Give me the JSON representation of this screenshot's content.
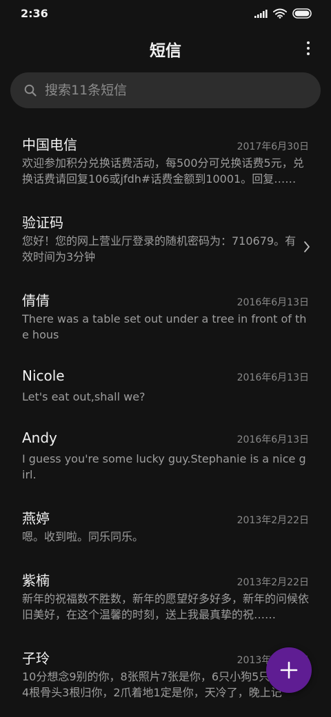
{
  "status_bar": {
    "time": "2:36",
    "icons": [
      "signal-icon",
      "wifi-icon",
      "battery-icon"
    ]
  },
  "app_bar": {
    "title": "短信",
    "menu_icon": "more-vertical-icon"
  },
  "search": {
    "placeholder": "搜索11条短信",
    "icon": "search-icon"
  },
  "conversations": [
    {
      "sender": "中国电信",
      "date": "2017年6月30日",
      "preview": "欢迎参加积分兑换话费活动，每500分可兑换话费5元，兑换话费请回复106或jfdh#话费金额到10001。回复……"
    },
    {
      "sender": "验证码",
      "date": "",
      "preview": "您好！您的网上营业厅登录的随机密码为：710679。有效时间为3分钟",
      "has_chevron": true
    },
    {
      "sender": "倩倩",
      "date": "2016年6月13日",
      "preview": "There was a table set out under a tree in front of the hous"
    },
    {
      "sender": "Nicole",
      "date": "2016年6月13日",
      "preview": "Let's eat out,shall we?"
    },
    {
      "sender": "Andy",
      "date": "2016年6月13日",
      "preview": "I guess you're some lucky guy.Stephanie is a nice girl."
    },
    {
      "sender": "燕婷",
      "date": "2013年2月22日",
      "preview": "嗯。收到啦。同乐同乐。"
    },
    {
      "sender": "紫楠",
      "date": "2013年2月22日",
      "preview": "新年的祝福数不胜数，新年的愿望好多好多，新年的问候依旧美好，在这个温馨的时刻，送上我最真挚的祝……"
    },
    {
      "sender": "子玲",
      "date": "2013年2月22日",
      "preview": "10分想念9别的你，8张照片7张是你，6只小狗5只是你，4根骨头3根归你，2爪着地1定是你，天冷了，晚上记"
    }
  ],
  "fab": {
    "icon": "plus-icon",
    "color": "#5f1d93"
  }
}
